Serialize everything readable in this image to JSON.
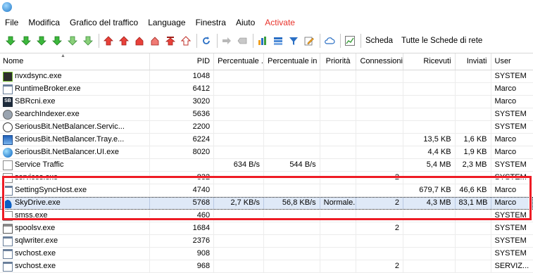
{
  "menu": [
    "File",
    "Modifica",
    "Grafico del traffico",
    "Language",
    "Finestra",
    "Aiuto",
    "Activate"
  ],
  "toolbar": {
    "label": "Scheda",
    "tab_select": "Tutte le Schede di rete",
    "icons": [
      "arrow-down-icon",
      "arrow-down-icon",
      "arrow-down-icon",
      "arrow-down-icon",
      "arrow-down-icon",
      "arrow-down-icon",
      "arrow-up-icon",
      "arrow-up-icon",
      "home-icon",
      "home-icon",
      "arrow-up-icon",
      "arrow-up-icon",
      "refresh-icon",
      "arrow-right-icon",
      "delete-icon",
      "bar-chart-icon",
      "rules-icon",
      "filter-icon",
      "edit-icon",
      "cloud-icon",
      "line-chart-icon"
    ]
  },
  "columns": [
    "Nome",
    "PID",
    "Percentuale ...",
    "Percentuale in ...",
    "Priorità",
    "Connessioni",
    "Ricevuti",
    "Inviati",
    "User"
  ],
  "rows": [
    {
      "name": "nvxdsync.exe",
      "pid": "1048",
      "pct_out": "",
      "pct_in": "",
      "prio": "",
      "conn": "",
      "recv": "",
      "sent": "",
      "user": "SYSTEM",
      "icon": "nvidia-icon"
    },
    {
      "name": "RuntimeBroker.exe",
      "pid": "6412",
      "pct_out": "",
      "pct_in": "",
      "prio": "",
      "conn": "",
      "recv": "",
      "sent": "",
      "user": "Marco",
      "icon": "window-icon"
    },
    {
      "name": "SBRcni.exe",
      "pid": "3020",
      "pct_out": "",
      "pct_in": "",
      "prio": "",
      "conn": "",
      "recv": "",
      "sent": "",
      "user": "Marco",
      "icon": "sb-icon"
    },
    {
      "name": "SearchIndexer.exe",
      "pid": "5636",
      "pct_out": "",
      "pct_in": "",
      "prio": "",
      "conn": "",
      "recv": "",
      "sent": "",
      "user": "SYSTEM",
      "icon": "person-icon"
    },
    {
      "name": "SeriousBit.NetBalancer.Servic...",
      "pid": "2200",
      "pct_out": "",
      "pct_in": "",
      "prio": "",
      "conn": "",
      "recv": "",
      "sent": "",
      "user": "SYSTEM",
      "icon": "globe-icon"
    },
    {
      "name": "SeriousBit.NetBalancer.Tray.e...",
      "pid": "6224",
      "pct_out": "",
      "pct_in": "",
      "prio": "",
      "conn": "",
      "recv": "13,5 KB",
      "sent": "1,6 KB",
      "user": "Marco",
      "icon": "netbalancer-icon"
    },
    {
      "name": "SeriousBit.NetBalancer.UI.exe",
      "pid": "8020",
      "pct_out": "",
      "pct_in": "",
      "prio": "",
      "conn": "",
      "recv": "4,4 KB",
      "sent": "1,9 KB",
      "user": "Marco",
      "icon": "blue-ball-icon"
    },
    {
      "name": "Service Traffic",
      "pid": "",
      "pct_out": "634 B/s",
      "pct_in": "544 B/s",
      "prio": "",
      "conn": "",
      "recv": "5,4 MB",
      "sent": "2,3 MB",
      "user": "SYSTEM",
      "icon": "page-icon"
    },
    {
      "name": "services.exe",
      "pid": "832",
      "pct_out": "",
      "pct_in": "",
      "prio": "",
      "conn": "2",
      "recv": "",
      "sent": "",
      "user": "SYSTEM",
      "icon": "page-icon"
    },
    {
      "name": "SettingSyncHost.exe",
      "pid": "4740",
      "pct_out": "",
      "pct_in": "",
      "prio": "",
      "conn": "",
      "recv": "679,7 KB",
      "sent": "46,6 KB",
      "user": "Marco",
      "icon": "window-icon"
    },
    {
      "name": "SkyDrive.exe",
      "pid": "5768",
      "pct_out": "2,7 KB/s",
      "pct_in": "56,8 KB/s",
      "prio": "Normale...",
      "conn": "2",
      "recv": "4,3 MB",
      "sent": "83,1 MB",
      "user": "Marco",
      "icon": "skydrive-icon"
    },
    {
      "name": "smss.exe",
      "pid": "460",
      "pct_out": "",
      "pct_in": "",
      "prio": "",
      "conn": "",
      "recv": "",
      "sent": "",
      "user": "SYSTEM",
      "icon": "page-icon"
    },
    {
      "name": "spoolsv.exe",
      "pid": "1684",
      "pct_out": "",
      "pct_in": "",
      "prio": "",
      "conn": "2",
      "recv": "",
      "sent": "",
      "user": "SYSTEM",
      "icon": "printer-icon"
    },
    {
      "name": "sqlwriter.exe",
      "pid": "2376",
      "pct_out": "",
      "pct_in": "",
      "prio": "",
      "conn": "",
      "recv": "",
      "sent": "",
      "user": "SYSTEM",
      "icon": "window-icon"
    },
    {
      "name": "svchost.exe",
      "pid": "908",
      "pct_out": "",
      "pct_in": "",
      "prio": "",
      "conn": "",
      "recv": "",
      "sent": "",
      "user": "SYSTEM",
      "icon": "window-icon"
    },
    {
      "name": "svchost.exe",
      "pid": "968",
      "pct_out": "",
      "pct_in": "",
      "prio": "",
      "conn": "2",
      "recv": "",
      "sent": "",
      "user": "SERVIZ...",
      "icon": "window-icon"
    }
  ],
  "selected_row": 10,
  "colors": {
    "highlight_border": "#ee1c25",
    "activate_menu": "#e8322a",
    "selection": "#dfe9f7"
  }
}
